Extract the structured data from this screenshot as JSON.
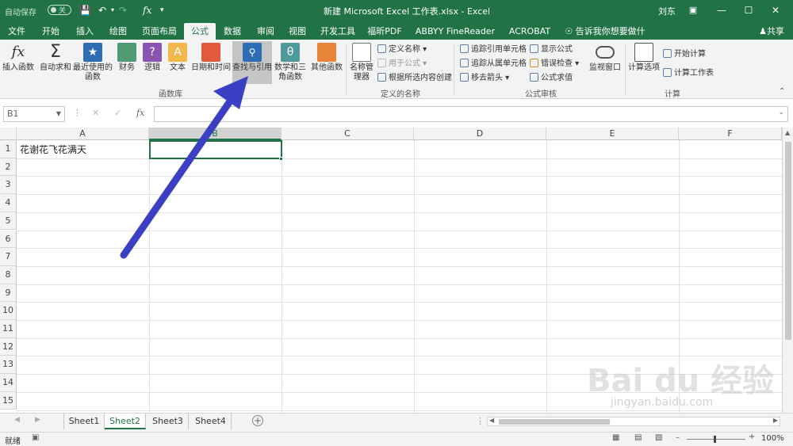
{
  "titlebar": {
    "autosave_label": "自动保存",
    "autosave_state": "关",
    "title": "新建 Microsoft Excel 工作表.xlsx  -  Excel",
    "user": "刘东",
    "icons": [
      "save-icon",
      "undo-icon",
      "redo-icon",
      "fx-icon",
      "customize-icon",
      "ribbon-options-icon",
      "minimize-icon",
      "maximize-icon",
      "close-icon"
    ]
  },
  "tabs": [
    "文件",
    "开始",
    "插入",
    "绘图",
    "页面布局",
    "公式",
    "数据",
    "审阅",
    "视图",
    "开发工具",
    "福昕PDF",
    "ABBYY FineReader 12",
    "ACROBAT"
  ],
  "active_tab": "公式",
  "tell_me": "告诉我你想要做什么",
  "share": "共享",
  "ribbon": {
    "function_library": {
      "buttons": [
        "插入函数",
        "自动求和",
        "最近使用的函数",
        "财务",
        "逻辑",
        "文本",
        "日期和时间",
        "查找与引用",
        "数学和三角函数",
        "其他函数"
      ],
      "group_label": "函数库"
    },
    "defined_names": {
      "big": "名称管理器",
      "items": [
        "定义名称",
        "用于公式",
        "根据所选内容创建"
      ],
      "group_label": "定义的名称"
    },
    "formula_auditing": {
      "items": [
        "追踪引用单元格",
        "追踪从属单元格",
        "移去箭头",
        "显示公式",
        "错误检查",
        "公式求值"
      ],
      "watch": "监视窗口",
      "group_label": "公式审核"
    },
    "calculation": {
      "big": "计算选项",
      "items": [
        "开始计算",
        "计算工作表"
      ],
      "group_label": "计算"
    },
    "accent": "#217346"
  },
  "formula_bar": {
    "name_box": "B1",
    "fx": "fx",
    "value": ""
  },
  "sheet": {
    "columns": [
      "A",
      "B",
      "C",
      "D",
      "E",
      "F"
    ],
    "rows": [
      "1",
      "2",
      "3",
      "4",
      "5",
      "6",
      "7",
      "8",
      "9",
      "10",
      "11",
      "12",
      "13",
      "14",
      "15"
    ],
    "cell_A1": "花谢花飞花满天",
    "selected": "B1"
  },
  "sheet_tabs": [
    "Sheet1",
    "Sheet2",
    "Sheet3",
    "Sheet4"
  ],
  "active_sheet": "Sheet2",
  "status": {
    "ready": "就绪",
    "zoom": "100%"
  },
  "watermark": {
    "brand": "Bai du 经验",
    "url": "jingyan.baidu.com"
  },
  "annotation_arrow_color": "#3a3fc4"
}
